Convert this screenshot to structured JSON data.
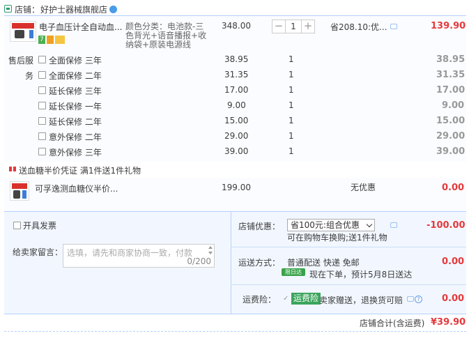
{
  "shop": {
    "label": "店铺：",
    "name": "好护士器械旗舰店"
  },
  "main_item": {
    "title": "电子血压计全自动血...",
    "sku_lines": [
      "颜色分类：电池款-三",
      "色背光+语音播报+收",
      "纳袋+原装电源线"
    ],
    "price": "348.00",
    "quantity": "1",
    "qty_minus": "−",
    "qty_plus": "+",
    "discount": "省208.10:优...",
    "subtotal": "139.90",
    "badge_7": "7"
  },
  "service": {
    "label_line1": "售后服",
    "label_line2": "务",
    "rows": [
      {
        "name": "全面保修  三年",
        "price": "38.95",
        "qty": "1",
        "total": "38.95"
      },
      {
        "name": "全面保修  二年",
        "price": "31.35",
        "qty": "1",
        "total": "31.35"
      },
      {
        "name": "延长保修  三年",
        "price": "17.00",
        "qty": "1",
        "total": "17.00"
      },
      {
        "name": "延长保修  一年",
        "price": "9.00",
        "qty": "1",
        "total": "9.00"
      },
      {
        "name": "延长保修  二年",
        "price": "15.00",
        "qty": "1",
        "total": "15.00"
      },
      {
        "name": "意外保修  二年",
        "price": "29.00",
        "qty": "1",
        "total": "29.00"
      },
      {
        "name": "意外保修  三年",
        "price": "39.00",
        "qty": "1",
        "total": "39.00"
      }
    ]
  },
  "gift": {
    "header": "送血糖半价凭证   满1件送1件礼物",
    "item_title": "可孚逸测血糖仪半价...",
    "price": "199.00",
    "discount": "无优惠",
    "total": "0.00"
  },
  "invoice": {
    "label": "开具发票"
  },
  "message": {
    "label": "给卖家留言：",
    "placeholder": "选填，请先和商家协商一致，付款",
    "count": "0/200"
  },
  "shop_promo": {
    "label": "店铺优惠：",
    "selected": "省100元:组合优惠",
    "note": "可在购物车换购;送1件礼物",
    "amount": "-100.00"
  },
  "delivery": {
    "label": "运送方式：",
    "method": "普通配送 快递 免邮",
    "badge": "限日达",
    "eta": "现在下单，预计5月8日送达",
    "amount": "0.00"
  },
  "insurance": {
    "label": "运费险：",
    "badge": "运费险",
    "text": "卖家赠送，退换货可赔",
    "amount": "0.00"
  },
  "summary": {
    "label": "店铺合计(含运费)",
    "amount": "¥39.90"
  },
  "colors": {
    "accent_red": "#e4393c",
    "border_blue": "#b2d1ff",
    "panel_bg": "#f2f7ff",
    "green": "#3ba55c"
  }
}
